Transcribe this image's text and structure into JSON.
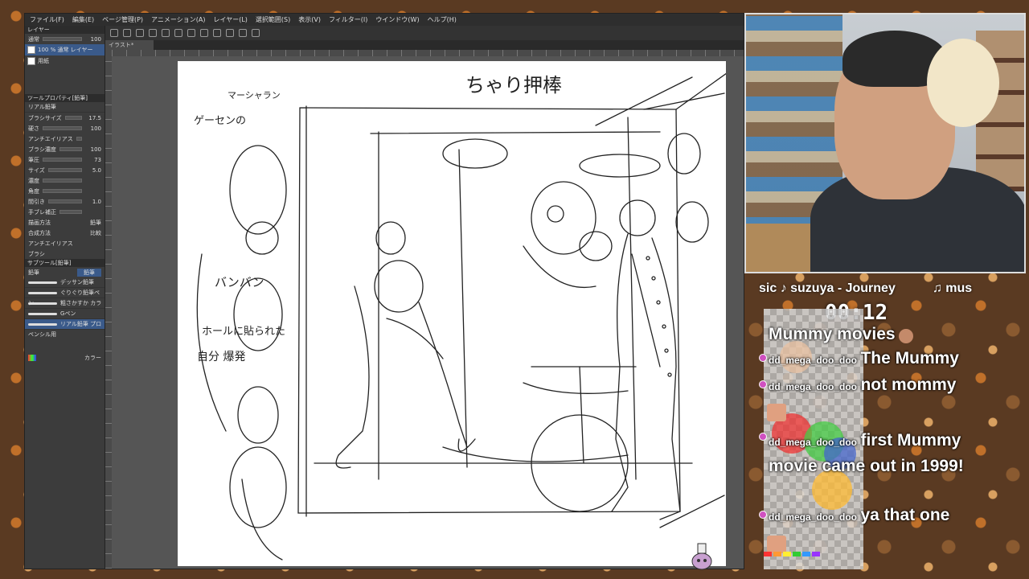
{
  "menu": {
    "items": [
      "ファイル(F)",
      "編集(E)",
      "ページ管理(P)",
      "アニメーション(A)",
      "レイヤー(L)",
      "選択範囲(S)",
      "表示(V)",
      "フィルター(I)",
      "ウインドウ(W)",
      "ヘルプ(H)"
    ]
  },
  "document": {
    "tab_label": "イラスト*"
  },
  "layers": {
    "panel_title": "レイヤー",
    "blend_mode": "通常",
    "opacity": "100",
    "items": [
      {
        "name": "100 % 通常 レイヤー",
        "selected": true
      },
      {
        "name": "用紙",
        "selected": false
      }
    ]
  },
  "tool_property": {
    "title": "ツールプロパティ[鉛筆]",
    "subtool": "リアル鉛筆",
    "rows": [
      {
        "label": "ブラシサイズ",
        "value": "17.5"
      },
      {
        "label": "硬さ",
        "value": "100"
      },
      {
        "label": "アンチエイリアス",
        "value": ""
      },
      {
        "label": "ブラシ濃度",
        "value": "100"
      },
      {
        "label": "筆圧",
        "value": "73"
      },
      {
        "label": "サイズ",
        "value": "5.0"
      },
      {
        "label": "濃度",
        "value": ""
      },
      {
        "label": "角度",
        "value": ""
      },
      {
        "label": "間引き",
        "value": "1.0"
      },
      {
        "label": "手ブレ補正",
        "value": ""
      },
      {
        "label": "描画方法",
        "value": "鉛筆"
      },
      {
        "label": "合成方法",
        "value": "比較"
      },
      {
        "label": "アンチエイリアス",
        "value": ""
      },
      {
        "label": "ブラシ",
        "value": ""
      }
    ]
  },
  "subtools": {
    "title": "サブツール[鉛筆]",
    "tabs": [
      "鉛筆",
      "鉛筆"
    ],
    "brushes": [
      "デッサン鉛筆",
      "ぐりぐり鉛筆ペン",
      "粗さかすか カラー",
      "Gペン",
      "リアル鉛筆 プロペンシル用"
    ]
  },
  "color_panel": {
    "label": "カラー"
  },
  "sketch": {
    "title": "ちゃり押棒",
    "notes": [
      "マーシャラン",
      "ゲーセンの",
      "バンバン",
      "ホールに貼られた",
      "自分 爆発"
    ]
  },
  "stream": {
    "ticker": [
      "sic ♪ suzuya - Journey",
      "♫ mus"
    ],
    "timer": "00:12"
  },
  "chat": {
    "messages": [
      {
        "user": "",
        "text": "Mummy movies"
      },
      {
        "user": "dd_mega_doo_doo",
        "text": "The Mummy"
      },
      {
        "user": "dd_mega_doo_doo",
        "text": "not mommy"
      },
      {
        "user": "dd_mega_doo_doo",
        "text": "first Mummy movie came out in 1999!"
      },
      {
        "user": "dd_mega_doo_doo",
        "text": "ya that one"
      }
    ]
  },
  "colors": {
    "badge": "#d050c0",
    "app_bg": "#3a3a3a",
    "canvas_bg": "#555555"
  }
}
